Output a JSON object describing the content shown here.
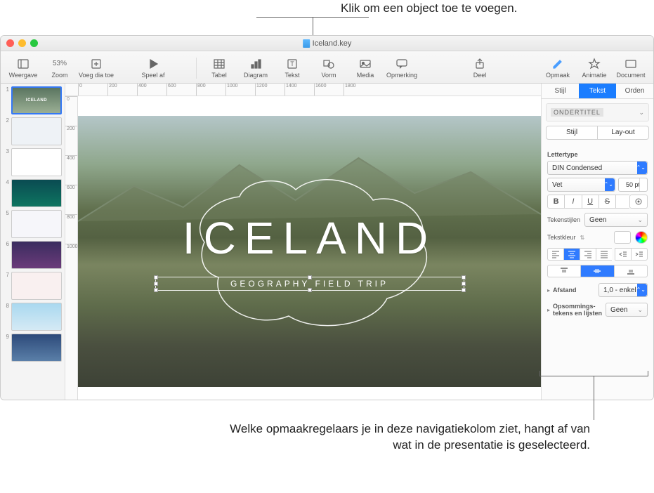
{
  "callouts": {
    "top": "Klik om een object toe te voegen.",
    "bottom": "Welke opmaakregelaars je in deze navigatiekolom ziet, hangt af van wat in de presentatie is geselecteerd."
  },
  "titlebar": {
    "document": "Iceland.key"
  },
  "toolbar": {
    "view": "Weergave",
    "zoom_pct": "53%",
    "zoom": "Zoom",
    "add_slide": "Voeg dia toe",
    "play": "Speel af",
    "table": "Tabel",
    "chart": "Diagram",
    "text": "Tekst",
    "shape": "Vorm",
    "media": "Media",
    "comment": "Opmerking",
    "share": "Deel",
    "format": "Opmaak",
    "animate": "Animatie",
    "document": "Document"
  },
  "ruler_h": [
    "0",
    "200",
    "400",
    "600",
    "800",
    "1000",
    "1200",
    "1400",
    "1600",
    "1800"
  ],
  "ruler_v": [
    "0",
    "200",
    "400",
    "600",
    "800",
    "1000"
  ],
  "slides": [
    1,
    2,
    3,
    4,
    5,
    6,
    7,
    8,
    9
  ],
  "main_slide": {
    "title": "ICELAND",
    "subtitle": "GEOGRAPHY FIELD TRIP"
  },
  "inspector": {
    "tabs": {
      "style": "Stijl",
      "text": "Tekst",
      "order": "Orden"
    },
    "paragraph_style": "Ondertitel",
    "subtabs": {
      "style": "Stijl",
      "layout": "Lay-out"
    },
    "font_label": "Lettertype",
    "font_family": "DIN Condensed",
    "font_weight": "Vet",
    "font_size": "50 pt",
    "char_styles": "Tekenstijlen",
    "char_styles_val": "Geen",
    "text_color": "Tekstkleur",
    "spacing": "Afstand",
    "spacing_val": "1,0 - enkel",
    "bullets": "Opsommings-\ntekens en lijsten",
    "bullets_val": "Geen"
  }
}
